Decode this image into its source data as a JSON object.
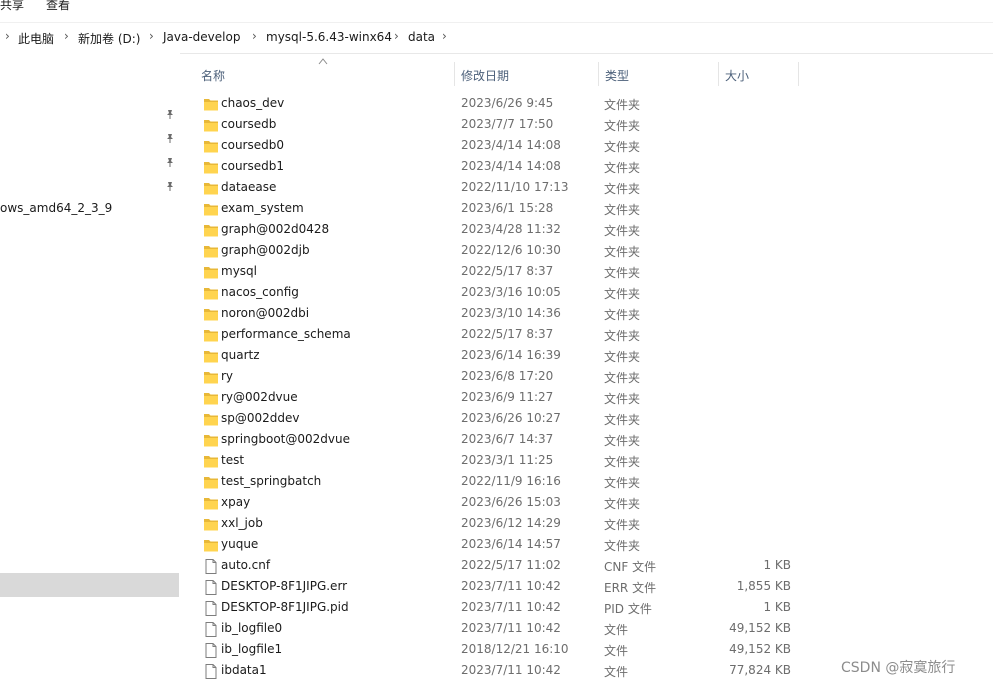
{
  "ribbon": {
    "share_label": "共享",
    "view_label": "查看"
  },
  "breadcrumb": {
    "items": [
      "此电脑",
      "新加卷 (D:)",
      "Java-develop",
      "mysql-5.6.43-winx64",
      "data"
    ]
  },
  "nav": {
    "truncated_item": "ows_amd64_2_3_9"
  },
  "columns": {
    "name": "名称",
    "modified": "修改日期",
    "type": "类型",
    "size": "大小"
  },
  "files": [
    {
      "name": "chaos_dev",
      "modified": "2023/6/26 9:45",
      "type": "文件夹",
      "size": "",
      "kind": "folder"
    },
    {
      "name": "coursedb",
      "modified": "2023/7/7 17:50",
      "type": "文件夹",
      "size": "",
      "kind": "folder"
    },
    {
      "name": "coursedb0",
      "modified": "2023/4/14 14:08",
      "type": "文件夹",
      "size": "",
      "kind": "folder"
    },
    {
      "name": "coursedb1",
      "modified": "2023/4/14 14:08",
      "type": "文件夹",
      "size": "",
      "kind": "folder"
    },
    {
      "name": "dataease",
      "modified": "2022/11/10 17:13",
      "type": "文件夹",
      "size": "",
      "kind": "folder"
    },
    {
      "name": "exam_system",
      "modified": "2023/6/1 15:28",
      "type": "文件夹",
      "size": "",
      "kind": "folder"
    },
    {
      "name": "graph@002d0428",
      "modified": "2023/4/28 11:32",
      "type": "文件夹",
      "size": "",
      "kind": "folder"
    },
    {
      "name": "graph@002djb",
      "modified": "2022/12/6 10:30",
      "type": "文件夹",
      "size": "",
      "kind": "folder"
    },
    {
      "name": "mysql",
      "modified": "2022/5/17 8:37",
      "type": "文件夹",
      "size": "",
      "kind": "folder"
    },
    {
      "name": "nacos_config",
      "modified": "2023/3/16 10:05",
      "type": "文件夹",
      "size": "",
      "kind": "folder"
    },
    {
      "name": "noron@002dbi",
      "modified": "2023/3/10 14:36",
      "type": "文件夹",
      "size": "",
      "kind": "folder"
    },
    {
      "name": "performance_schema",
      "modified": "2022/5/17 8:37",
      "type": "文件夹",
      "size": "",
      "kind": "folder"
    },
    {
      "name": "quartz",
      "modified": "2023/6/14 16:39",
      "type": "文件夹",
      "size": "",
      "kind": "folder"
    },
    {
      "name": "ry",
      "modified": "2023/6/8 17:20",
      "type": "文件夹",
      "size": "",
      "kind": "folder"
    },
    {
      "name": "ry@002dvue",
      "modified": "2023/6/9 11:27",
      "type": "文件夹",
      "size": "",
      "kind": "folder"
    },
    {
      "name": "sp@002ddev",
      "modified": "2023/6/26 10:27",
      "type": "文件夹",
      "size": "",
      "kind": "folder"
    },
    {
      "name": "springboot@002dvue",
      "modified": "2023/6/7 14:37",
      "type": "文件夹",
      "size": "",
      "kind": "folder"
    },
    {
      "name": "test",
      "modified": "2023/3/1 11:25",
      "type": "文件夹",
      "size": "",
      "kind": "folder"
    },
    {
      "name": "test_springbatch",
      "modified": "2022/11/9 16:16",
      "type": "文件夹",
      "size": "",
      "kind": "folder"
    },
    {
      "name": "xpay",
      "modified": "2023/6/26 15:03",
      "type": "文件夹",
      "size": "",
      "kind": "folder"
    },
    {
      "name": "xxl_job",
      "modified": "2023/6/12 14:29",
      "type": "文件夹",
      "size": "",
      "kind": "folder"
    },
    {
      "name": "yuque",
      "modified": "2023/6/14 14:57",
      "type": "文件夹",
      "size": "",
      "kind": "folder"
    },
    {
      "name": "auto.cnf",
      "modified": "2022/5/17 11:02",
      "type": "CNF 文件",
      "size": "1 KB",
      "kind": "file"
    },
    {
      "name": "DESKTOP-8F1JIPG.err",
      "modified": "2023/7/11 10:42",
      "type": "ERR 文件",
      "size": "1,855 KB",
      "kind": "file"
    },
    {
      "name": "DESKTOP-8F1JIPG.pid",
      "modified": "2023/7/11 10:42",
      "type": "PID 文件",
      "size": "1 KB",
      "kind": "file"
    },
    {
      "name": "ib_logfile0",
      "modified": "2023/7/11 10:42",
      "type": "文件",
      "size": "49,152 KB",
      "kind": "file"
    },
    {
      "name": "ib_logfile1",
      "modified": "2018/12/21 16:10",
      "type": "文件",
      "size": "49,152 KB",
      "kind": "file"
    },
    {
      "name": "ibdata1",
      "modified": "2023/7/11 10:42",
      "type": "文件",
      "size": "77,824 KB",
      "kind": "file"
    }
  ],
  "watermark": "CSDN @寂寞旅行",
  "colors": {
    "folder_yellow": "#ffd44f",
    "folder_dark": "#e8b838",
    "selection_gray": "#d9d9d9",
    "header_text": "#4c607a"
  }
}
